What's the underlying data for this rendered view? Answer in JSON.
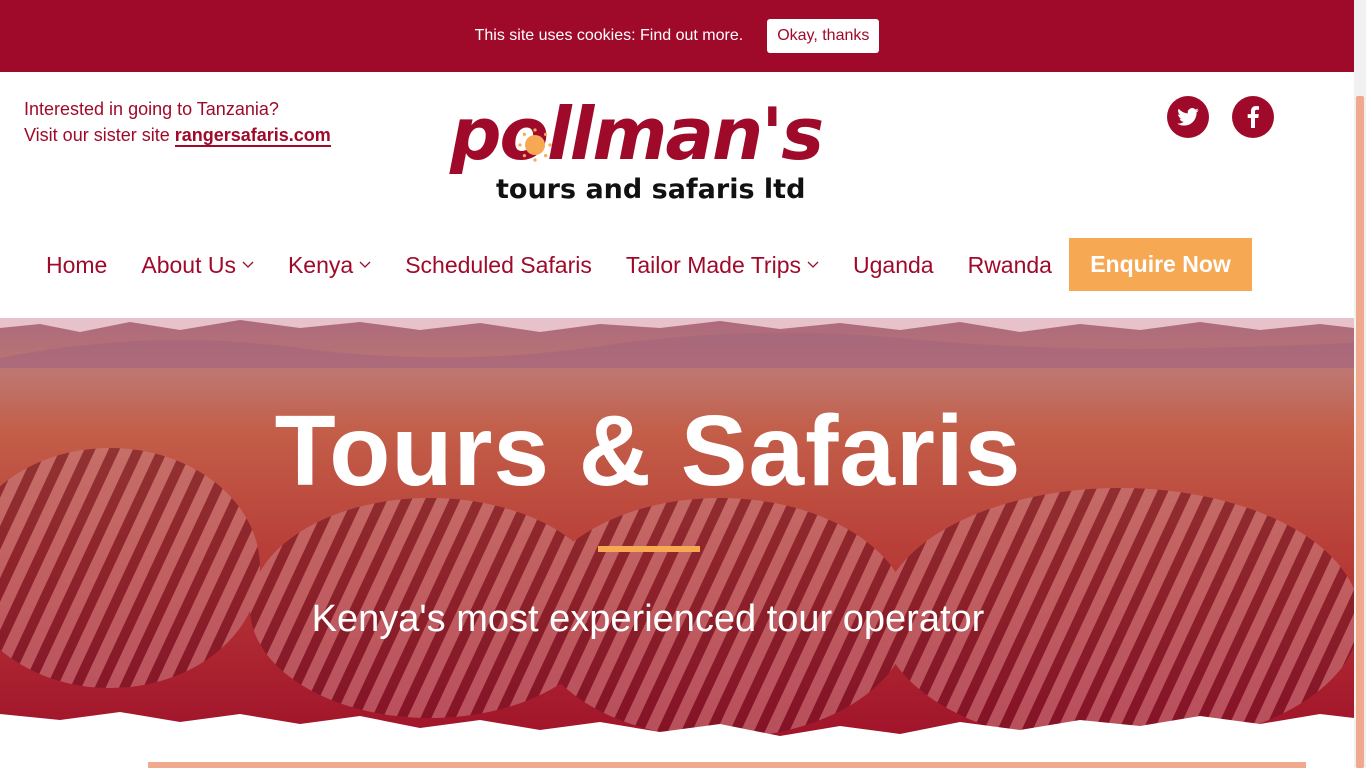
{
  "cookie": {
    "text": "This site uses cookies: Find out more.",
    "button": "Okay, thanks"
  },
  "header": {
    "sister_line1": "Interested in going to Tanzania?",
    "sister_line2_prefix": "Visit our sister site ",
    "sister_link": "rangersafaris.com",
    "logo_main": "pollman's",
    "logo_sub": "tours and safaris ltd",
    "social": [
      "twitter-icon",
      "facebook-icon"
    ]
  },
  "nav": {
    "items": [
      {
        "label": "Home",
        "dropdown": false
      },
      {
        "label": "About Us",
        "dropdown": true
      },
      {
        "label": "Kenya",
        "dropdown": true
      },
      {
        "label": "Scheduled Safaris",
        "dropdown": false
      },
      {
        "label": "Tailor Made Trips",
        "dropdown": true
      },
      {
        "label": "Uganda",
        "dropdown": false
      },
      {
        "label": "Rwanda",
        "dropdown": false
      }
    ],
    "cta": "Enquire Now"
  },
  "hero": {
    "title": "Tours & Safaris",
    "subtitle": "Kenya's most experienced tour operator"
  },
  "colors": {
    "brand": "#a00a2a",
    "accent": "#f7a853"
  }
}
